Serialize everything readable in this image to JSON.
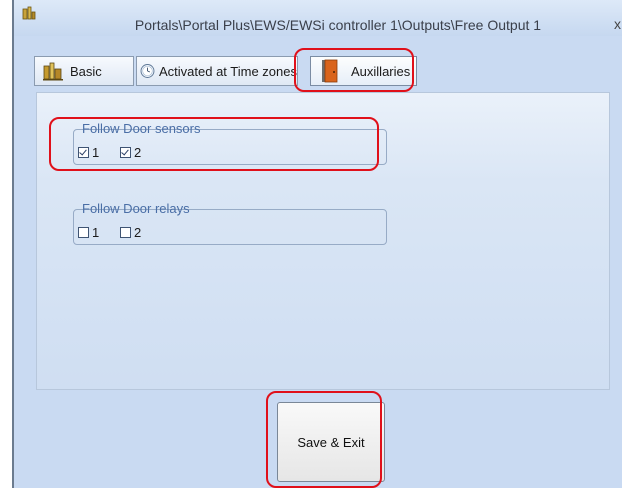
{
  "window": {
    "title": "Portals\\Portal Plus\\EWS/EWSi controller 1\\Outputs\\Free Output 1",
    "close_label": "x"
  },
  "tabs": [
    {
      "label": "Basic",
      "icon": "books-icon"
    },
    {
      "label": "Activated at Time zones",
      "icon": "clock-icon"
    },
    {
      "label": "Auxillaries",
      "icon": "door-icon"
    }
  ],
  "sensors": {
    "legend": "Follow Door sensors",
    "items": [
      {
        "label": "1",
        "checked": true
      },
      {
        "label": "2",
        "checked": true
      }
    ]
  },
  "relays": {
    "legend": "Follow Door relays",
    "items": [
      {
        "label": "1",
        "checked": false
      },
      {
        "label": "2",
        "checked": false
      }
    ]
  },
  "save_label": "Save & Exit",
  "colors": {
    "highlight": "#e0101a",
    "legend": "#4a6ea6",
    "window_bg": "#c9daf2"
  }
}
